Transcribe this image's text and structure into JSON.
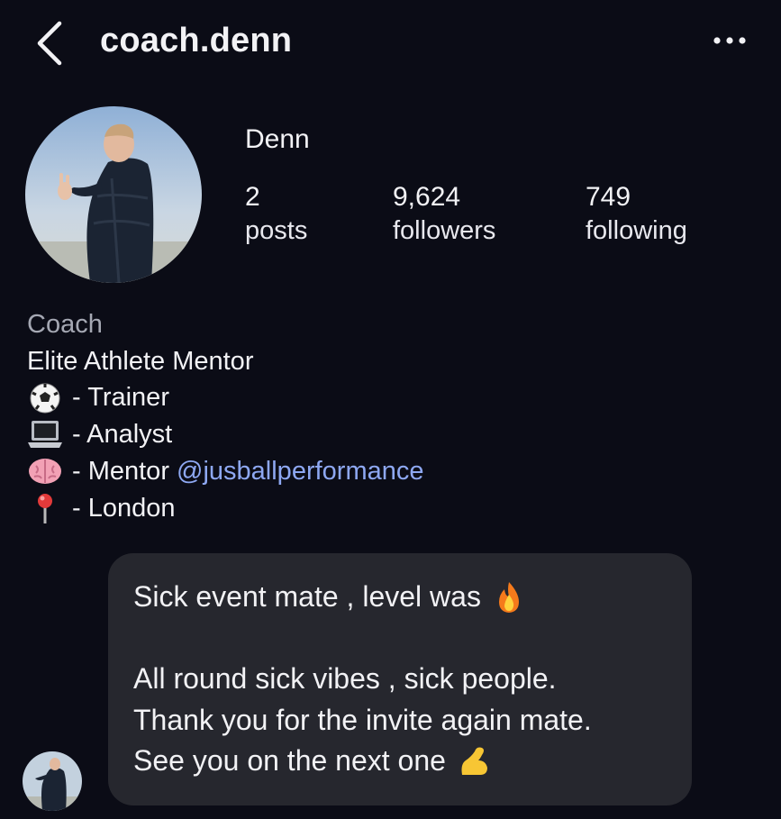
{
  "header": {
    "username": "coach.denn",
    "back_icon": "chevron-left-icon",
    "more_icon": "more-horizontal-icon"
  },
  "profile": {
    "display_name": "Denn",
    "stats": [
      {
        "value": "2",
        "label": "posts"
      },
      {
        "value": "9,624",
        "label": "followers"
      },
      {
        "value": "749",
        "label": "following"
      }
    ],
    "category": "Coach",
    "bio_lines": [
      {
        "icon": "soccer-ball-icon",
        "text": "- Trainer"
      },
      {
        "icon": "laptop-icon",
        "text": "- Analyst"
      },
      {
        "icon": "brain-icon",
        "text": "- Mentor ",
        "mention": "@jusballperformance"
      },
      {
        "icon": "round-pushpin-icon",
        "text": "- London"
      }
    ],
    "tagline": "Elite Athlete Mentor"
  },
  "message": {
    "line1": "Sick event mate , level was",
    "line1_emoji": "fire-icon",
    "line2": "All round sick vibes , sick people.",
    "line3": "Thank you for the invite again mate.",
    "line4": "See you on the next one",
    "line4_emoji": "flexed-biceps-icon"
  },
  "colors": {
    "background": "#0b0c16",
    "bubble": "#26272e",
    "mention": "#8ea8f2",
    "category": "#a5a8b3"
  }
}
